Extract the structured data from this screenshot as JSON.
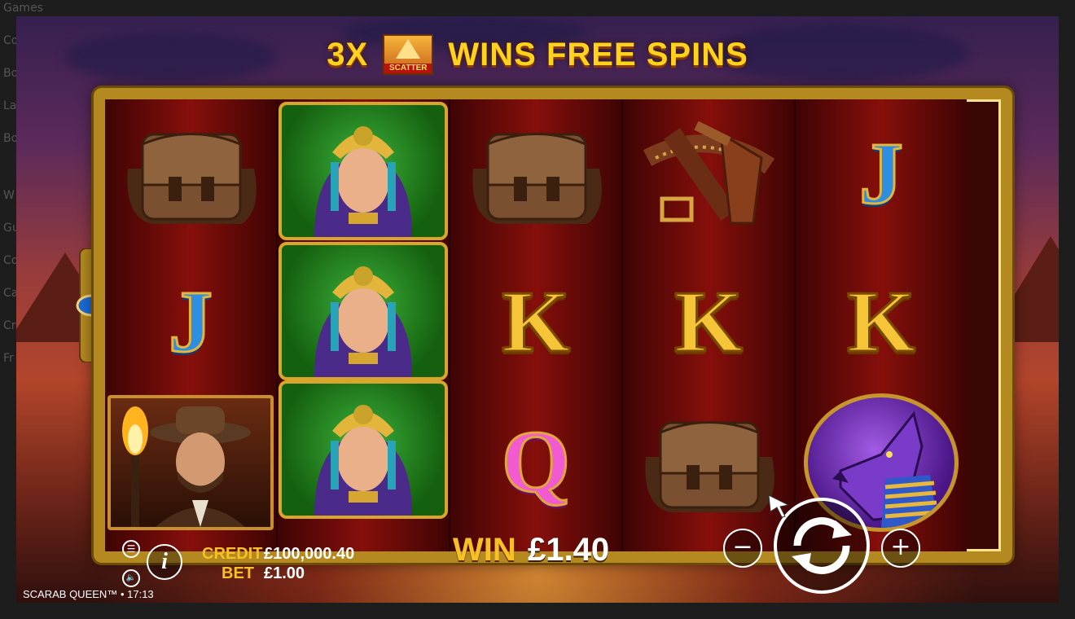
{
  "page_behind": {
    "nav_fragments": [
      "Games",
      "Co",
      "Bo",
      "La",
      "Bo",
      "W",
      "Gu",
      "Co",
      "Ca",
      "Cr",
      "Fr"
    ]
  },
  "banner": {
    "prefix": "3X",
    "scatter_label": "SCATTER",
    "suffix": "WINS FREE SPINS"
  },
  "reels": [
    {
      "symbols": [
        "satchel",
        "J",
        "explorer"
      ]
    },
    {
      "symbols": [
        "queen",
        "queen",
        "queen"
      ]
    },
    {
      "symbols": [
        "satchel",
        "K",
        "Q"
      ]
    },
    {
      "symbols": [
        "gun-belt",
        "K",
        "satchel"
      ]
    },
    {
      "symbols": [
        "J",
        "K",
        "anubis"
      ]
    }
  ],
  "hud": {
    "credit_label": "CREDIT",
    "credit_value": "£100,000.40",
    "bet_label": "BET",
    "bet_value": "£1.00",
    "win_label": "WIN",
    "win_value": "£1.40",
    "minus_label": "−",
    "plus_label": "+",
    "info_label": "i",
    "menu_label": "☰",
    "sound_label": "🔈"
  },
  "footer": {
    "game_name": "SCARAB QUEEN™",
    "separator": "•",
    "time": "17:13"
  },
  "colors": {
    "gold": "#f6c026",
    "frame": "#b4891f",
    "reel_red": "#860f0b"
  }
}
